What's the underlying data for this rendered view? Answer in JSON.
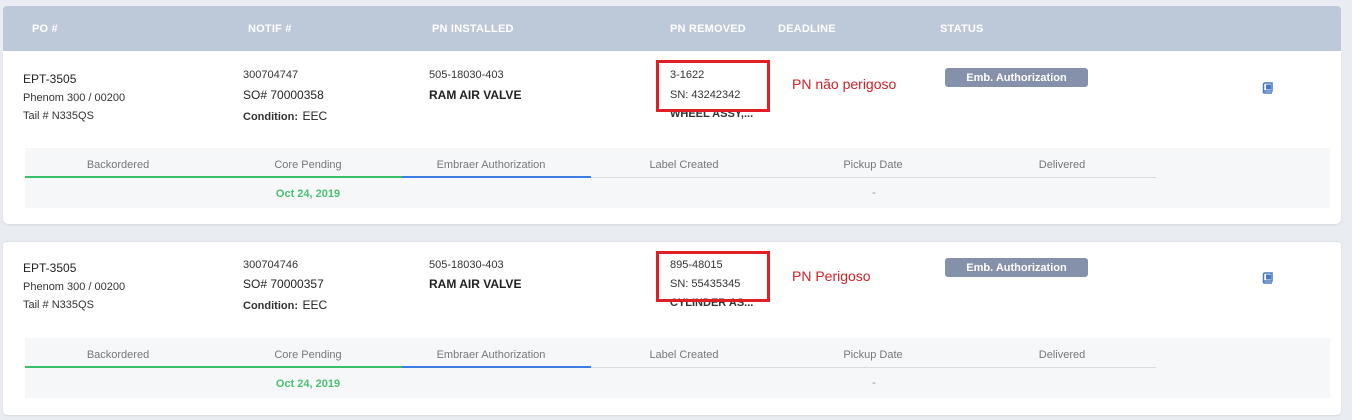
{
  "header": {
    "po": "PO #",
    "notif": "NOTIF #",
    "pn_installed": "PN INSTALLED",
    "pn_removed": "PN REMOVED",
    "deadline": "DEADLINE",
    "status": "STATUS"
  },
  "rows": [
    {
      "po": "EPT-3505",
      "aircraft": "Phenom 300 / 00200",
      "tail": "Tail # N335QS",
      "notif": "300704747",
      "so": "SO# 70000358",
      "condition_label": "Condition:",
      "condition_value": "EEC",
      "pn_installed": "505-18030-403",
      "pn_installed_desc": "RAM AIR VALVE",
      "pn_removed": "3-1622",
      "sn": "SN: 43242342",
      "pn_removed_desc": "WHEEL ASSY,...",
      "annotation": "PN não perigoso",
      "status": "Emb. Authorization",
      "tracker": {
        "steps": [
          "Backordered",
          "Core Pending",
          "Embraer Authorization",
          "Label Created",
          "Pickup Date",
          "Delivered"
        ],
        "core_date": "Oct 24, 2019",
        "pickup_value": "-"
      }
    },
    {
      "po": "EPT-3505",
      "aircraft": "Phenom 300 / 00200",
      "tail": "Tail # N335QS",
      "notif": "300704746",
      "so": "SO# 70000357",
      "condition_label": "Condition:",
      "condition_value": "EEC",
      "pn_installed": "505-18030-403",
      "pn_installed_desc": "RAM AIR VALVE",
      "pn_removed": "895-48015",
      "sn": "SN: 55435345",
      "pn_removed_desc": "CYLINDER AS...",
      "annotation": "PN Perigoso",
      "status": "Emb. Authorization",
      "tracker": {
        "steps": [
          "Backordered",
          "Core Pending",
          "Embraer Authorization",
          "Label Created",
          "Pickup Date",
          "Delivered"
        ],
        "core_date": "Oct 24, 2019",
        "pickup_value": "-"
      }
    }
  ],
  "colors": {
    "header_bg": "#bdc8d9",
    "annotation_red": "#d02028",
    "status_badge": "#8590aa",
    "progress_green": "#3bbf6a",
    "progress_blue": "#3b7ee0"
  },
  "icons": {
    "details": "book-icon"
  }
}
